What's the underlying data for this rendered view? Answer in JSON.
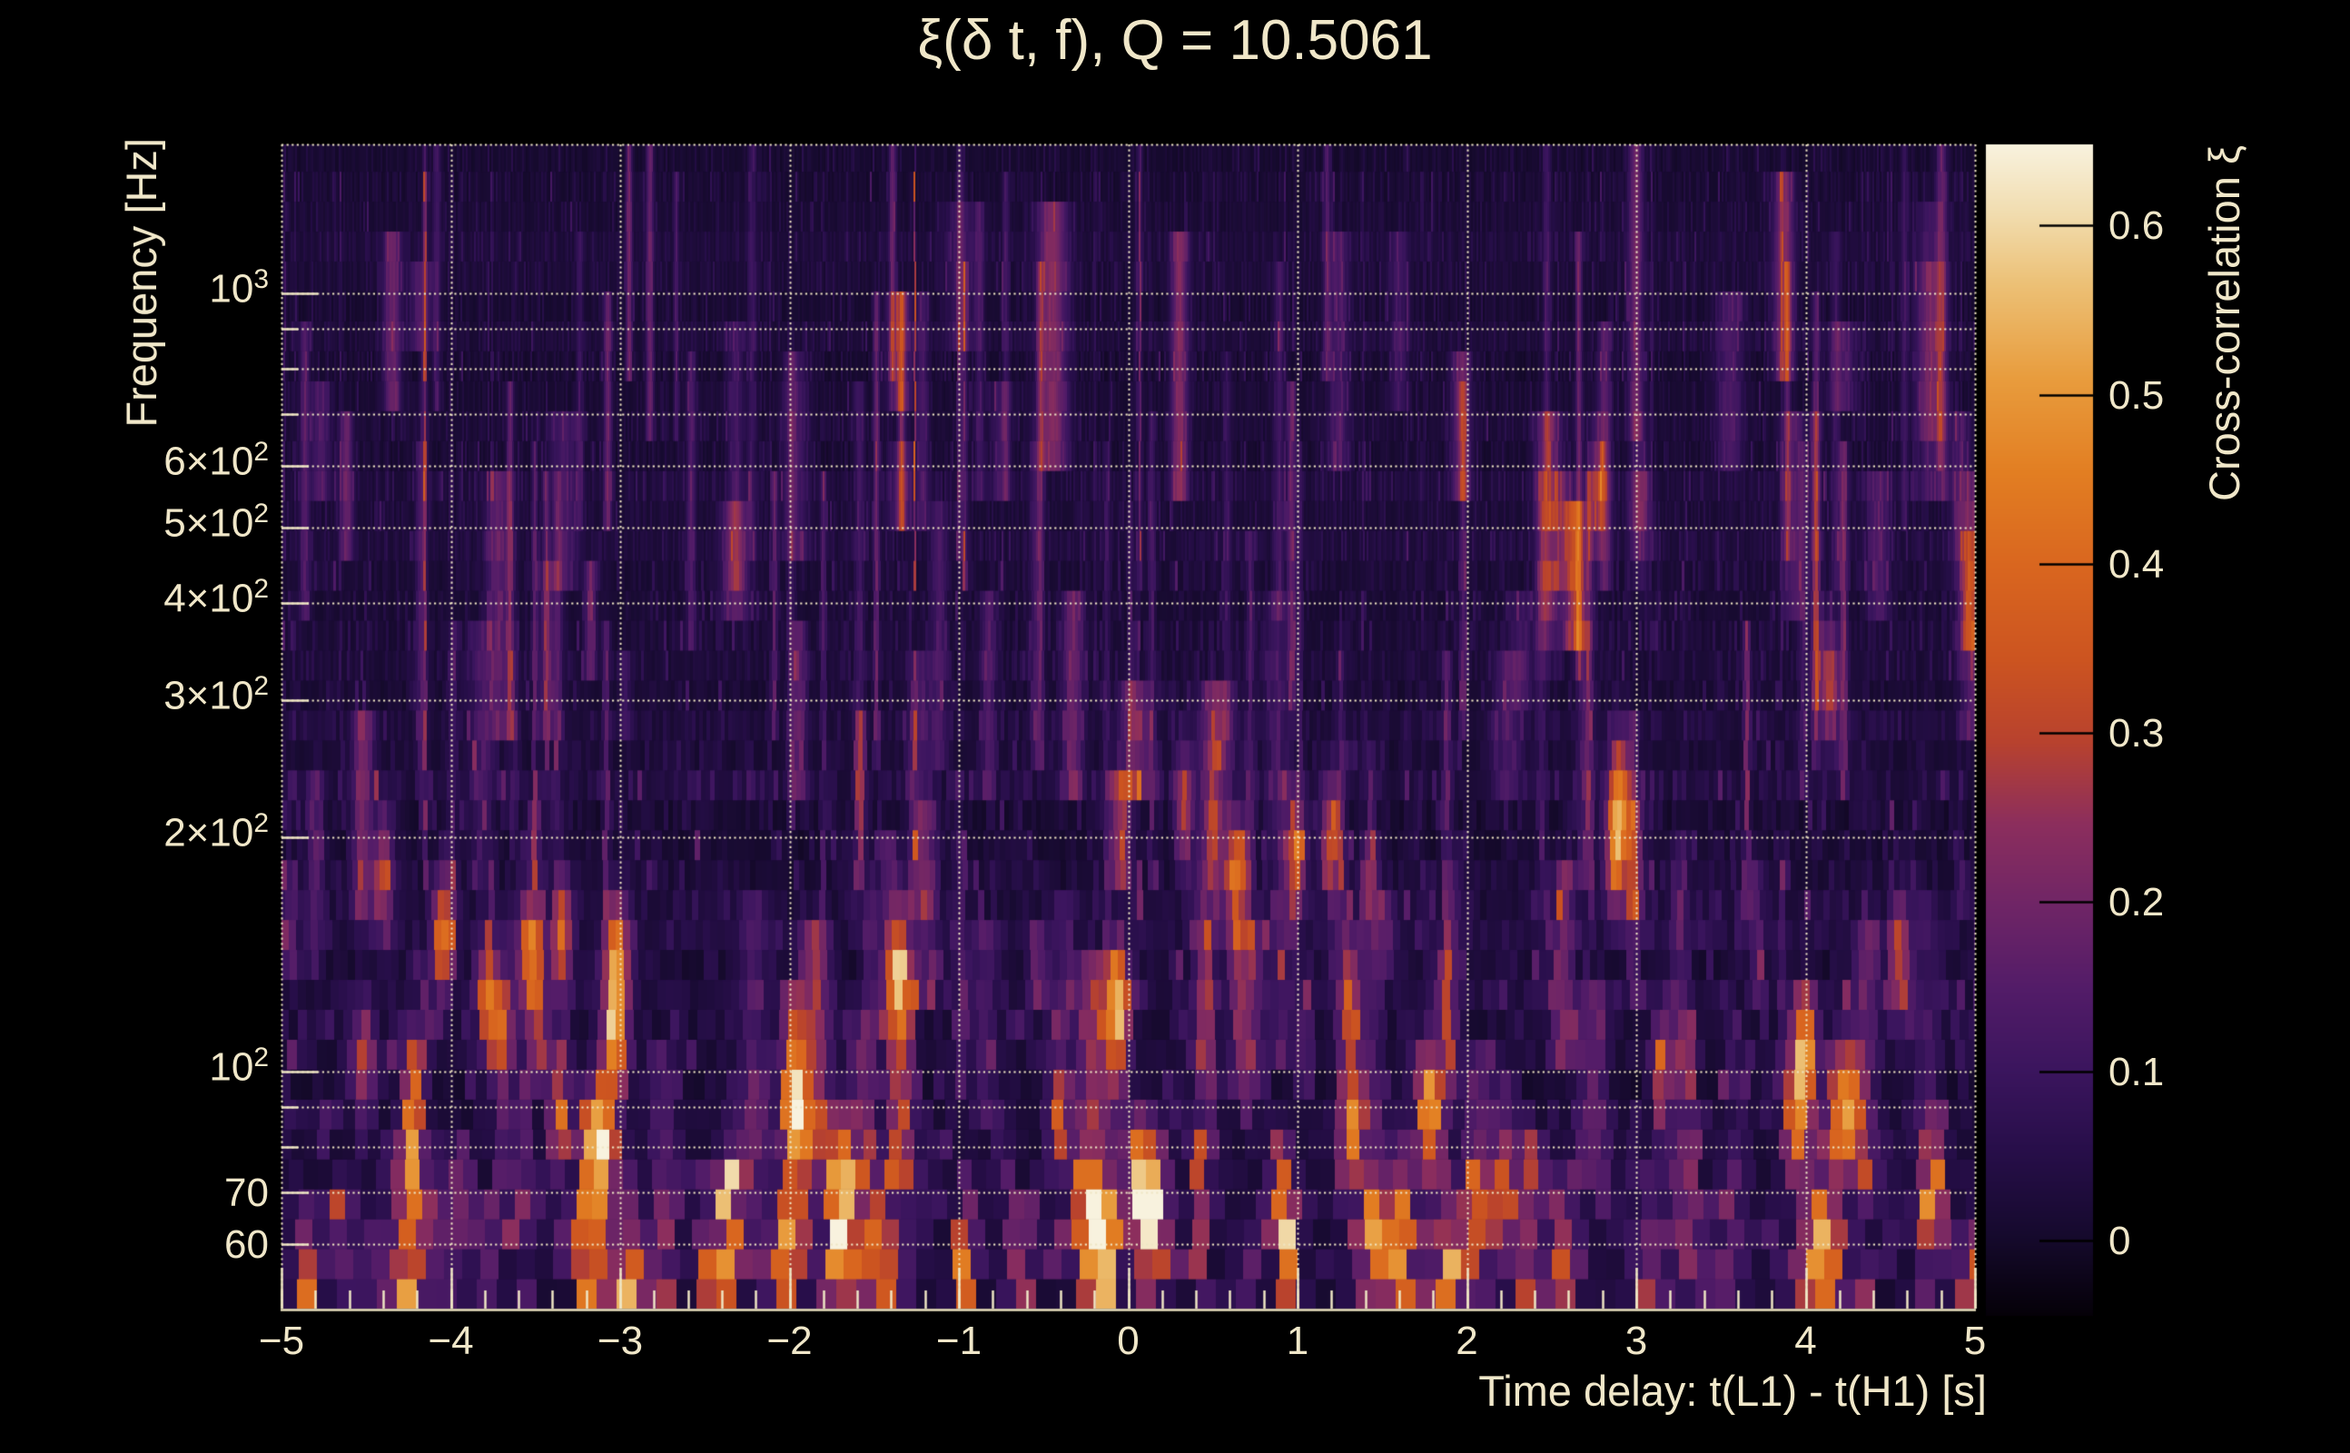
{
  "title": "ξ(δ t, f), Q = 10.5061",
  "colors": {
    "background": "#000000",
    "text": "#f0e7c9",
    "axis": "#efe6c4",
    "grid": "#efe6c4",
    "colorbar_tick": "#000000"
  },
  "chart_data": {
    "type": "heatmap",
    "title": "ξ(δ t, f), Q = 10.5061",
    "Q": 10.5061,
    "xlabel": "Time delay: t(L1) - t(H1) [s]",
    "ylabel": "Frequency [Hz]",
    "colorbar_label": "Cross-correlation ξ",
    "x_range": [
      -5,
      5
    ],
    "x_scale": "linear",
    "y_range": [
      49.6,
      1554
    ],
    "y_scale": "log",
    "z_range": [
      -0.044,
      0.648
    ],
    "grid": "dotted",
    "legend_position": "right-colorbar",
    "x_tick_labels": [
      {
        "t": -5,
        "label": "−5"
      },
      {
        "t": -4,
        "label": "−4"
      },
      {
        "t": -3,
        "label": "−3"
      },
      {
        "t": -2,
        "label": "−2"
      },
      {
        "t": -1,
        "label": "−1"
      },
      {
        "t": 0,
        "label": "0"
      },
      {
        "t": 1,
        "label": "1"
      },
      {
        "t": 2,
        "label": "2"
      },
      {
        "t": 3,
        "label": "3"
      },
      {
        "t": 4,
        "label": "4"
      },
      {
        "t": 5,
        "label": "5"
      }
    ],
    "x_minor_step": 0.2,
    "y_tick_labels": [
      {
        "f": 1000,
        "m": "10",
        "e": "3"
      },
      {
        "f": 600,
        "m": "6×10",
        "e": "2"
      },
      {
        "f": 500,
        "m": "5×10",
        "e": "2"
      },
      {
        "f": 400,
        "m": "4×10",
        "e": "2"
      },
      {
        "f": 300,
        "m": "3×10",
        "e": "2"
      },
      {
        "f": 200,
        "m": "2×10",
        "e": "2"
      },
      {
        "f": 100,
        "m": "10",
        "e": "2"
      },
      {
        "f": 70,
        "m": "70",
        "e": ""
      },
      {
        "f": 60,
        "m": "60",
        "e": ""
      }
    ],
    "y_grid": [
      1000,
      900,
      800,
      700,
      600,
      500,
      400,
      300,
      200,
      100,
      90,
      80,
      70,
      60
    ],
    "y_ticks_long": [
      1000,
      100
    ],
    "y_ticks_medium": [
      600,
      500,
      400,
      300,
      200,
      70,
      60
    ],
    "y_ticks_short": [
      900,
      800,
      700,
      90,
      80
    ],
    "colorbar_ticks": [
      {
        "v": 0.6,
        "label": "0.6"
      },
      {
        "v": 0.5,
        "label": "0.5"
      },
      {
        "v": 0.4,
        "label": "0.4"
      },
      {
        "v": 0.3,
        "label": "0.3"
      },
      {
        "v": 0.2,
        "label": "0.2"
      },
      {
        "v": 0.1,
        "label": "0.1"
      },
      {
        "v": 0.0,
        "label": "0"
      }
    ],
    "colormap_stops": [
      [
        0.0,
        "#050108"
      ],
      [
        0.07,
        "#160a2e"
      ],
      [
        0.14,
        "#270e49"
      ],
      [
        0.21,
        "#3b155e"
      ],
      [
        0.28,
        "#531c68"
      ],
      [
        0.35,
        "#6f2566"
      ],
      [
        0.42,
        "#8c2e5d"
      ],
      [
        0.49,
        "#b8422e"
      ],
      [
        0.56,
        "#cc5420"
      ],
      [
        0.64,
        "#d9661f"
      ],
      [
        0.72,
        "#e27e22"
      ],
      [
        0.8,
        "#e89c3d"
      ],
      [
        0.88,
        "#ecc075"
      ],
      [
        0.94,
        "#f1dcae"
      ],
      [
        1.0,
        "#f8f2de"
      ]
    ],
    "hotspots_columns": [
      "dt_s",
      "freq_hz",
      "xi"
    ],
    "hotspots": [
      [
        -4.87,
        53,
        0.34
      ],
      [
        -4.51,
        103,
        0.3
      ],
      [
        -4.4,
        180,
        0.28
      ],
      [
        -4.25,
        52,
        0.5
      ],
      [
        -4.24,
        73,
        0.45
      ],
      [
        -4.22,
        96,
        0.38
      ],
      [
        -4.05,
        150,
        0.4
      ],
      [
        -3.78,
        125,
        0.4
      ],
      [
        -3.69,
        112,
        0.34
      ],
      [
        -3.55,
        140,
        0.32
      ],
      [
        -3.36,
        90,
        0.32
      ],
      [
        -3.34,
        150,
        0.34
      ],
      [
        -3.11,
        85,
        0.45
      ],
      [
        -3.03,
        110,
        0.42
      ],
      [
        -3.02,
        140,
        0.45
      ],
      [
        -2.94,
        52,
        0.48
      ],
      [
        -2.76,
        52,
        0.34
      ],
      [
        -2.5,
        54,
        0.28
      ],
      [
        -2.37,
        67,
        0.3
      ],
      [
        -2.02,
        57,
        0.36
      ],
      [
        -1.96,
        95,
        0.38
      ],
      [
        -1.7,
        61,
        0.66
      ],
      [
        -1.7,
        76,
        0.4
      ],
      [
        -1.35,
        140,
        0.33
      ],
      [
        -0.95,
        57,
        0.33
      ],
      [
        -0.41,
        88,
        0.36
      ],
      [
        -0.23,
        62,
        0.48
      ],
      [
        -0.15,
        57,
        0.4
      ],
      [
        -0.06,
        120,
        0.45
      ],
      [
        0.06,
        72,
        0.5
      ],
      [
        0.16,
        68,
        0.55
      ],
      [
        0.33,
        220,
        0.28
      ],
      [
        0.5,
        210,
        0.33
      ],
      [
        0.64,
        180,
        0.42
      ],
      [
        0.95,
        60,
        0.3
      ],
      [
        0.99,
        190,
        0.3
      ],
      [
        1.2,
        200,
        0.32
      ],
      [
        1.3,
        125,
        0.36
      ],
      [
        1.32,
        85,
        0.46
      ],
      [
        1.47,
        64,
        0.5
      ],
      [
        1.62,
        60,
        0.38
      ],
      [
        1.77,
        90,
        0.45
      ],
      [
        1.9,
        57,
        0.4
      ],
      [
        2.02,
        65,
        0.28
      ],
      [
        2.22,
        70,
        0.3
      ],
      [
        2.48,
        420,
        0.24
      ],
      [
        2.55,
        57,
        0.3
      ],
      [
        2.77,
        560,
        0.24
      ],
      [
        2.88,
        193,
        0.4
      ],
      [
        2.9,
        230,
        0.33
      ],
      [
        3.02,
        530,
        0.22
      ],
      [
        3.15,
        100,
        0.3
      ],
      [
        3.93,
        88,
        0.34
      ],
      [
        4.0,
        105,
        0.42
      ],
      [
        4.04,
        52,
        0.32
      ],
      [
        4.14,
        315,
        0.28
      ],
      [
        4.2,
        92,
        0.38
      ],
      [
        4.28,
        90,
        0.36
      ],
      [
        4.55,
        140,
        0.28
      ],
      [
        4.75,
        70,
        0.4
      ],
      [
        4.97,
        420,
        0.26
      ],
      [
        4.98,
        52,
        0.38
      ]
    ],
    "texture": {
      "seed": 1337,
      "rows_per_decade": 26,
      "tile_width_const": 1150,
      "n_minor_streaks": 150,
      "n_tall_streaks": 60,
      "base_noise": 0.032
    }
  }
}
